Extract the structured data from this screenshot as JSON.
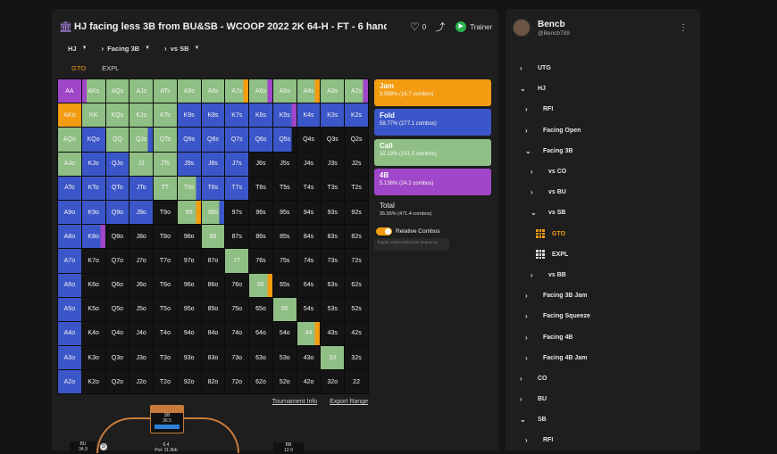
{
  "header": {
    "title": "HJ facing less 3B from BU&SB - WCOOP 2022 2K 64-H - FT - 6 handed (6",
    "likes": "0",
    "trainer": "Trainer"
  },
  "filters": [
    {
      "label": "HJ"
    },
    {
      "label": "Facing 3B"
    },
    {
      "label": "vs SB"
    }
  ],
  "tabs": [
    {
      "label": "GTO",
      "active": true
    },
    {
      "label": "EXPL",
      "active": false
    }
  ],
  "colors": {
    "jam": "#f39c12",
    "fold": "#3b56c8",
    "call": "#8fbf84",
    "fourbet": "#a046c8",
    "check": "#141414"
  },
  "matrix": {
    "rows": [
      [
        [
          "AA",
          "P"
        ],
        [
          "AKs",
          "K"
        ],
        [
          "AQs",
          "C"
        ],
        [
          "AJs",
          "C"
        ],
        [
          "ATs",
          "C"
        ],
        [
          "A9s",
          "C"
        ],
        [
          "A8s",
          "C"
        ],
        [
          "A7s",
          "CJ"
        ],
        [
          "A6s",
          "CP"
        ],
        [
          "A5s",
          "C"
        ],
        [
          "A4s",
          "CJ"
        ],
        [
          "A3s",
          "C"
        ],
        [
          "A2s",
          "CP"
        ]
      ],
      [
        [
          "AKo",
          "J"
        ],
        [
          "KK",
          "C"
        ],
        [
          "KQs",
          "C"
        ],
        [
          "KJs",
          "C"
        ],
        [
          "KTs",
          "C"
        ],
        [
          "K9s",
          "F"
        ],
        [
          "K8s",
          "F"
        ],
        [
          "K7s",
          "F"
        ],
        [
          "K6s",
          "F"
        ],
        [
          "K5s",
          "FP"
        ],
        [
          "K4s",
          "F"
        ],
        [
          "K3s",
          "F"
        ],
        [
          "K2s",
          "F"
        ]
      ],
      [
        [
          "AQo",
          "C"
        ],
        [
          "KQo",
          "F"
        ],
        [
          "QQ",
          "C"
        ],
        [
          "QJs",
          "CF"
        ],
        [
          "QTs",
          "C"
        ],
        [
          "Q9s",
          "F"
        ],
        [
          "Q8s",
          "F"
        ],
        [
          "Q7s",
          "F"
        ],
        [
          "Q6s",
          "F"
        ],
        [
          "Q5s",
          "FX"
        ],
        [
          "Q4s",
          "X"
        ],
        [
          "Q3s",
          "X"
        ],
        [
          "Q2s",
          "X"
        ]
      ],
      [
        [
          "AJo",
          "C"
        ],
        [
          "KJo",
          "F"
        ],
        [
          "QJo",
          "F"
        ],
        [
          "JJ",
          "C"
        ],
        [
          "JTs",
          "C"
        ],
        [
          "J9s",
          "F"
        ],
        [
          "J8s",
          "F"
        ],
        [
          "J7s",
          "F"
        ],
        [
          "J6s",
          "X"
        ],
        [
          "J5s",
          "X"
        ],
        [
          "J4s",
          "X"
        ],
        [
          "J3s",
          "X"
        ],
        [
          "J2s",
          "X"
        ]
      ],
      [
        [
          "ATo",
          "F"
        ],
        [
          "KTo",
          "F"
        ],
        [
          "QTo",
          "F"
        ],
        [
          "JTo",
          "F"
        ],
        [
          "TT",
          "C"
        ],
        [
          "T9s",
          "CF"
        ],
        [
          "T8s",
          "F"
        ],
        [
          "T7s",
          "F"
        ],
        [
          "T6s",
          "X"
        ],
        [
          "T5s",
          "X"
        ],
        [
          "T4s",
          "X"
        ],
        [
          "T3s",
          "X"
        ],
        [
          "T2s",
          "X"
        ]
      ],
      [
        [
          "A9o",
          "F"
        ],
        [
          "K9o",
          "F"
        ],
        [
          "Q9o",
          "F"
        ],
        [
          "J9o",
          "F"
        ],
        [
          "T9o",
          "X"
        ],
        [
          "99",
          "CJ"
        ],
        [
          "98s",
          "CF"
        ],
        [
          "97s",
          "X"
        ],
        [
          "96s",
          "X"
        ],
        [
          "95s",
          "X"
        ],
        [
          "94s",
          "X"
        ],
        [
          "93s",
          "X"
        ],
        [
          "92s",
          "X"
        ]
      ],
      [
        [
          "A8o",
          "F"
        ],
        [
          "K8o",
          "FP"
        ],
        [
          "Q8o",
          "X"
        ],
        [
          "J8o",
          "X"
        ],
        [
          "T8o",
          "X"
        ],
        [
          "98o",
          "X"
        ],
        [
          "88",
          "C"
        ],
        [
          "87s",
          "X"
        ],
        [
          "86s",
          "X"
        ],
        [
          "85s",
          "X"
        ],
        [
          "84s",
          "X"
        ],
        [
          "83s",
          "X"
        ],
        [
          "82s",
          "X"
        ]
      ],
      [
        [
          "A7o",
          "F"
        ],
        [
          "K7o",
          "X"
        ],
        [
          "Q7o",
          "X"
        ],
        [
          "J7o",
          "X"
        ],
        [
          "T7o",
          "X"
        ],
        [
          "97o",
          "X"
        ],
        [
          "87o",
          "X"
        ],
        [
          "77",
          "C"
        ],
        [
          "76s",
          "X"
        ],
        [
          "75s",
          "X"
        ],
        [
          "74s",
          "X"
        ],
        [
          "73s",
          "X"
        ],
        [
          "72s",
          "X"
        ]
      ],
      [
        [
          "A6o",
          "F"
        ],
        [
          "K6o",
          "X"
        ],
        [
          "Q6o",
          "X"
        ],
        [
          "J6o",
          "X"
        ],
        [
          "T6o",
          "X"
        ],
        [
          "96o",
          "X"
        ],
        [
          "86o",
          "X"
        ],
        [
          "76o",
          "X"
        ],
        [
          "66",
          "CJ"
        ],
        [
          "65s",
          "X"
        ],
        [
          "64s",
          "X"
        ],
        [
          "63s",
          "X"
        ],
        [
          "62s",
          "X"
        ]
      ],
      [
        [
          "A5o",
          "F"
        ],
        [
          "K5o",
          "X"
        ],
        [
          "Q5o",
          "X"
        ],
        [
          "J5o",
          "X"
        ],
        [
          "T5o",
          "X"
        ],
        [
          "95o",
          "X"
        ],
        [
          "85o",
          "X"
        ],
        [
          "75o",
          "X"
        ],
        [
          "65o",
          "X"
        ],
        [
          "55",
          "C"
        ],
        [
          "54s",
          "X"
        ],
        [
          "53s",
          "X"
        ],
        [
          "52s",
          "X"
        ]
      ],
      [
        [
          "A4o",
          "F"
        ],
        [
          "K4o",
          "X"
        ],
        [
          "Q4o",
          "X"
        ],
        [
          "J4o",
          "X"
        ],
        [
          "T4o",
          "X"
        ],
        [
          "94o",
          "X"
        ],
        [
          "84o",
          "X"
        ],
        [
          "74o",
          "X"
        ],
        [
          "64o",
          "X"
        ],
        [
          "54o",
          "X"
        ],
        [
          "44",
          "CJ"
        ],
        [
          "43s",
          "X"
        ],
        [
          "42s",
          "X"
        ]
      ],
      [
        [
          "A3o",
          "F"
        ],
        [
          "K3o",
          "X"
        ],
        [
          "Q3o",
          "X"
        ],
        [
          "J3o",
          "X"
        ],
        [
          "T3o",
          "X"
        ],
        [
          "93o",
          "X"
        ],
        [
          "83o",
          "X"
        ],
        [
          "73o",
          "X"
        ],
        [
          "63o",
          "X"
        ],
        [
          "53o",
          "X"
        ],
        [
          "43o",
          "X"
        ],
        [
          "33",
          "C"
        ],
        [
          "32s",
          "X"
        ]
      ],
      [
        [
          "A2o",
          "F"
        ],
        [
          "K2o",
          "X"
        ],
        [
          "Q2o",
          "X"
        ],
        [
          "J2o",
          "X"
        ],
        [
          "T2o",
          "X"
        ],
        [
          "92o",
          "X"
        ],
        [
          "82o",
          "X"
        ],
        [
          "72o",
          "X"
        ],
        [
          "62o",
          "X"
        ],
        [
          "52o",
          "X"
        ],
        [
          "42o",
          "X"
        ],
        [
          "32o",
          "X"
        ],
        [
          "22",
          "X"
        ]
      ]
    ]
  },
  "actions": [
    {
      "key": "jam",
      "name": "Jam",
      "pct": "3.958% (16.7 combos)"
    },
    {
      "key": "fold",
      "name": "Fold",
      "pct": "58.77% (277.1 combos)"
    },
    {
      "key": "call",
      "name": "Call",
      "pct": "32.13% (151.5 combos)"
    },
    {
      "key": "fourbet",
      "name": "4B",
      "pct": "5.136% (24.2 combos)"
    }
  ],
  "total": {
    "label": "Total",
    "value": "35.55% (471.4 combos)"
  },
  "relative_combos": {
    "label": "Relative Combos",
    "on": true,
    "hint": "Toggle relative/absolute frequency"
  },
  "links": {
    "tournament_info": "Tournament Info",
    "export_range": "Export Range"
  },
  "poker_table": {
    "top_seat": {
      "name": "SB",
      "stack": "36.5"
    },
    "left_seat": {
      "name": "BU",
      "stack": "34.9"
    },
    "right_seat": {
      "name": "BB",
      "stack": "12.9"
    },
    "pot": "6.4",
    "pot_label": "Pot: 11.3bb"
  },
  "profile": {
    "username": "Bencb",
    "handle": "@Bencb789"
  },
  "tree": [
    {
      "label": "UTG",
      "level": 0,
      "expanded": false
    },
    {
      "label": "HJ",
      "level": 0,
      "expanded": true
    },
    {
      "label": "RFI",
      "level": 1,
      "expanded": false
    },
    {
      "label": "Facing Open",
      "level": 1,
      "expanded": false
    },
    {
      "label": "Facing 3B",
      "level": 1,
      "expanded": true
    },
    {
      "label": "vs CO",
      "level": 2,
      "expanded": false
    },
    {
      "label": "vs BU",
      "level": 2,
      "expanded": false
    },
    {
      "label": "vs SB",
      "level": 2,
      "expanded": true
    },
    {
      "label": "GTO",
      "level": 3,
      "type": "grid",
      "selected": true
    },
    {
      "label": "EXPL",
      "level": 3,
      "type": "grid",
      "selected": false
    },
    {
      "label": "vs BB",
      "level": 2,
      "expanded": false
    },
    {
      "label": "Facing 3B Jam",
      "level": 1,
      "expanded": false
    },
    {
      "label": "Facing Squeeze",
      "level": 1,
      "expanded": false
    },
    {
      "label": "Facing 4B",
      "level": 1,
      "expanded": false
    },
    {
      "label": "Facing 4B Jam",
      "level": 1,
      "expanded": false
    },
    {
      "label": "CO",
      "level": 0,
      "expanded": false
    },
    {
      "label": "BU",
      "level": 0,
      "expanded": false
    },
    {
      "label": "SB",
      "level": 0,
      "expanded": true
    },
    {
      "label": "RFI",
      "level": 1,
      "expanded": false
    }
  ]
}
